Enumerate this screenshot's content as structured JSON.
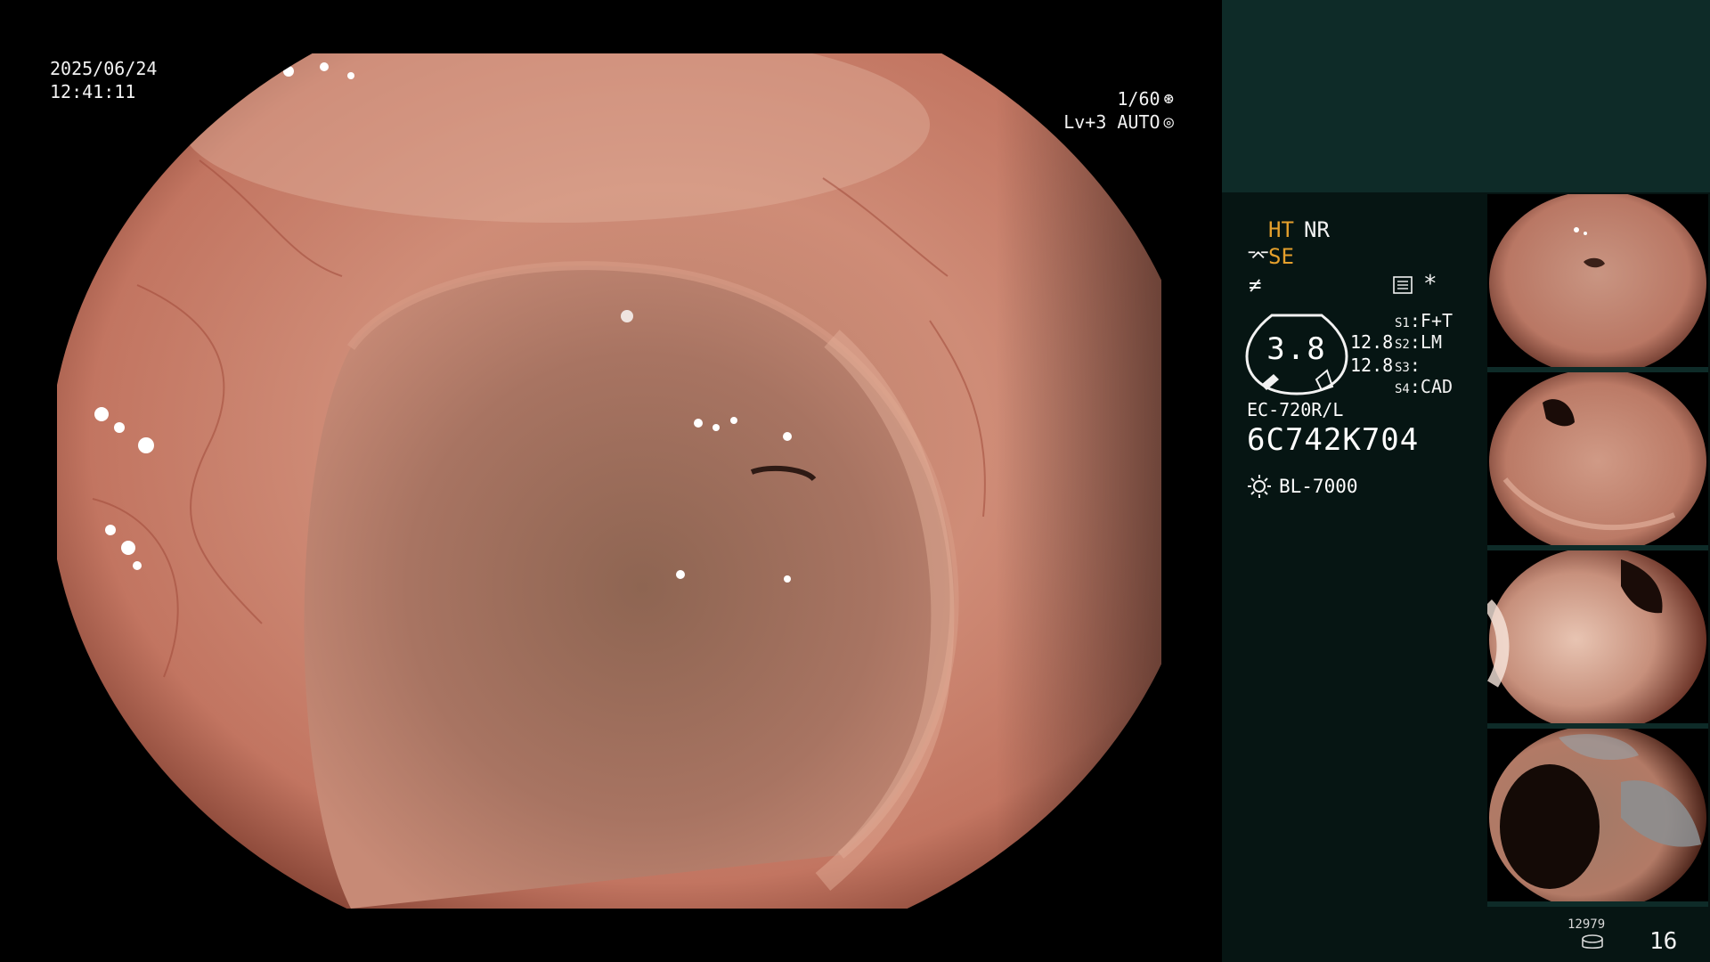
{
  "osd": {
    "date": "2025/06/24",
    "time": "12:41:11",
    "shutter": "1/60",
    "shutter_icon": "aperture-icon",
    "level": "Lv+3",
    "mode": "AUTO",
    "mode_icon": "iris-icon"
  },
  "status": {
    "ht": "HT",
    "nr": "NR",
    "se_icon": "enhance-icon",
    "se": "SE",
    "freeze_icon": "freeze-icon",
    "record_icon": "record-icon",
    "asterisk": "*",
    "gauge_value": "3.8",
    "side_top": "12.8",
    "side_bottom": "12.8",
    "switches": [
      {
        "key": "S1",
        "label": "F+T"
      },
      {
        "key": "S2",
        "label": "LM"
      },
      {
        "key": "S3",
        "label": ""
      },
      {
        "key": "S4",
        "label": "CAD"
      }
    ],
    "scope_model": "EC-720R/L",
    "serial": "6C742K704",
    "light_icon": "lamp-icon",
    "light_source": "BL-7000"
  },
  "thumbnails": [
    {
      "name": "capture-1",
      "scene": "fold-with-opening"
    },
    {
      "name": "capture-2",
      "scene": "dark-lumen"
    },
    {
      "name": "capture-3",
      "scene": "wall-with-lumen"
    },
    {
      "name": "capture-4",
      "scene": "lumen-with-debris"
    }
  ],
  "footer": {
    "count": "12979",
    "disk_icon": "storage-icon",
    "page": "16"
  },
  "colors": {
    "accent_orange": "#e5a02c",
    "panel_top": "#0e2b28",
    "panel_bg": "#061513",
    "mucosa": "#c9826e"
  }
}
